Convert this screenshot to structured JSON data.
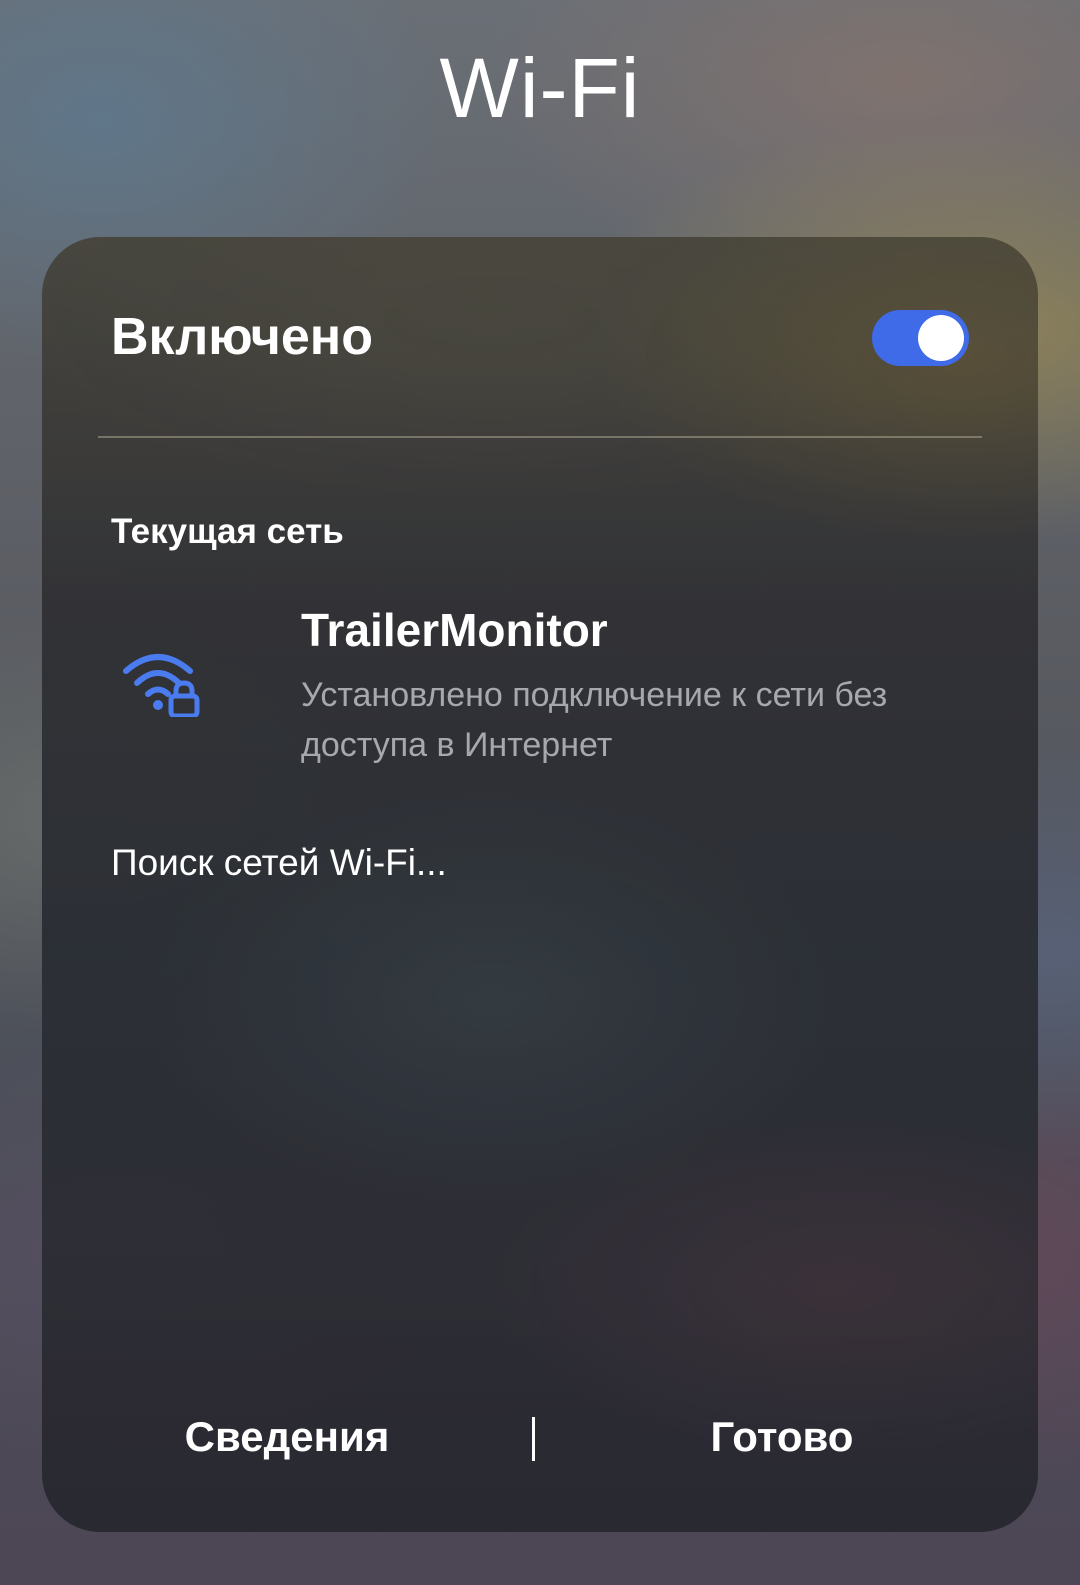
{
  "header": {
    "title": "Wi-Fi"
  },
  "wifi_toggle": {
    "label": "Включено",
    "state": "on",
    "accent_color": "#3f6ae8"
  },
  "current_network": {
    "heading": "Текущая сеть",
    "icon": "wifi-lock-icon",
    "name": "TrailerMonitor",
    "status": "Установлено подключение к сети без доступа в Интернет"
  },
  "scan": {
    "text": "Поиск сетей Wi-Fi..."
  },
  "footer": {
    "details_label": "Сведения",
    "done_label": "Готово"
  }
}
